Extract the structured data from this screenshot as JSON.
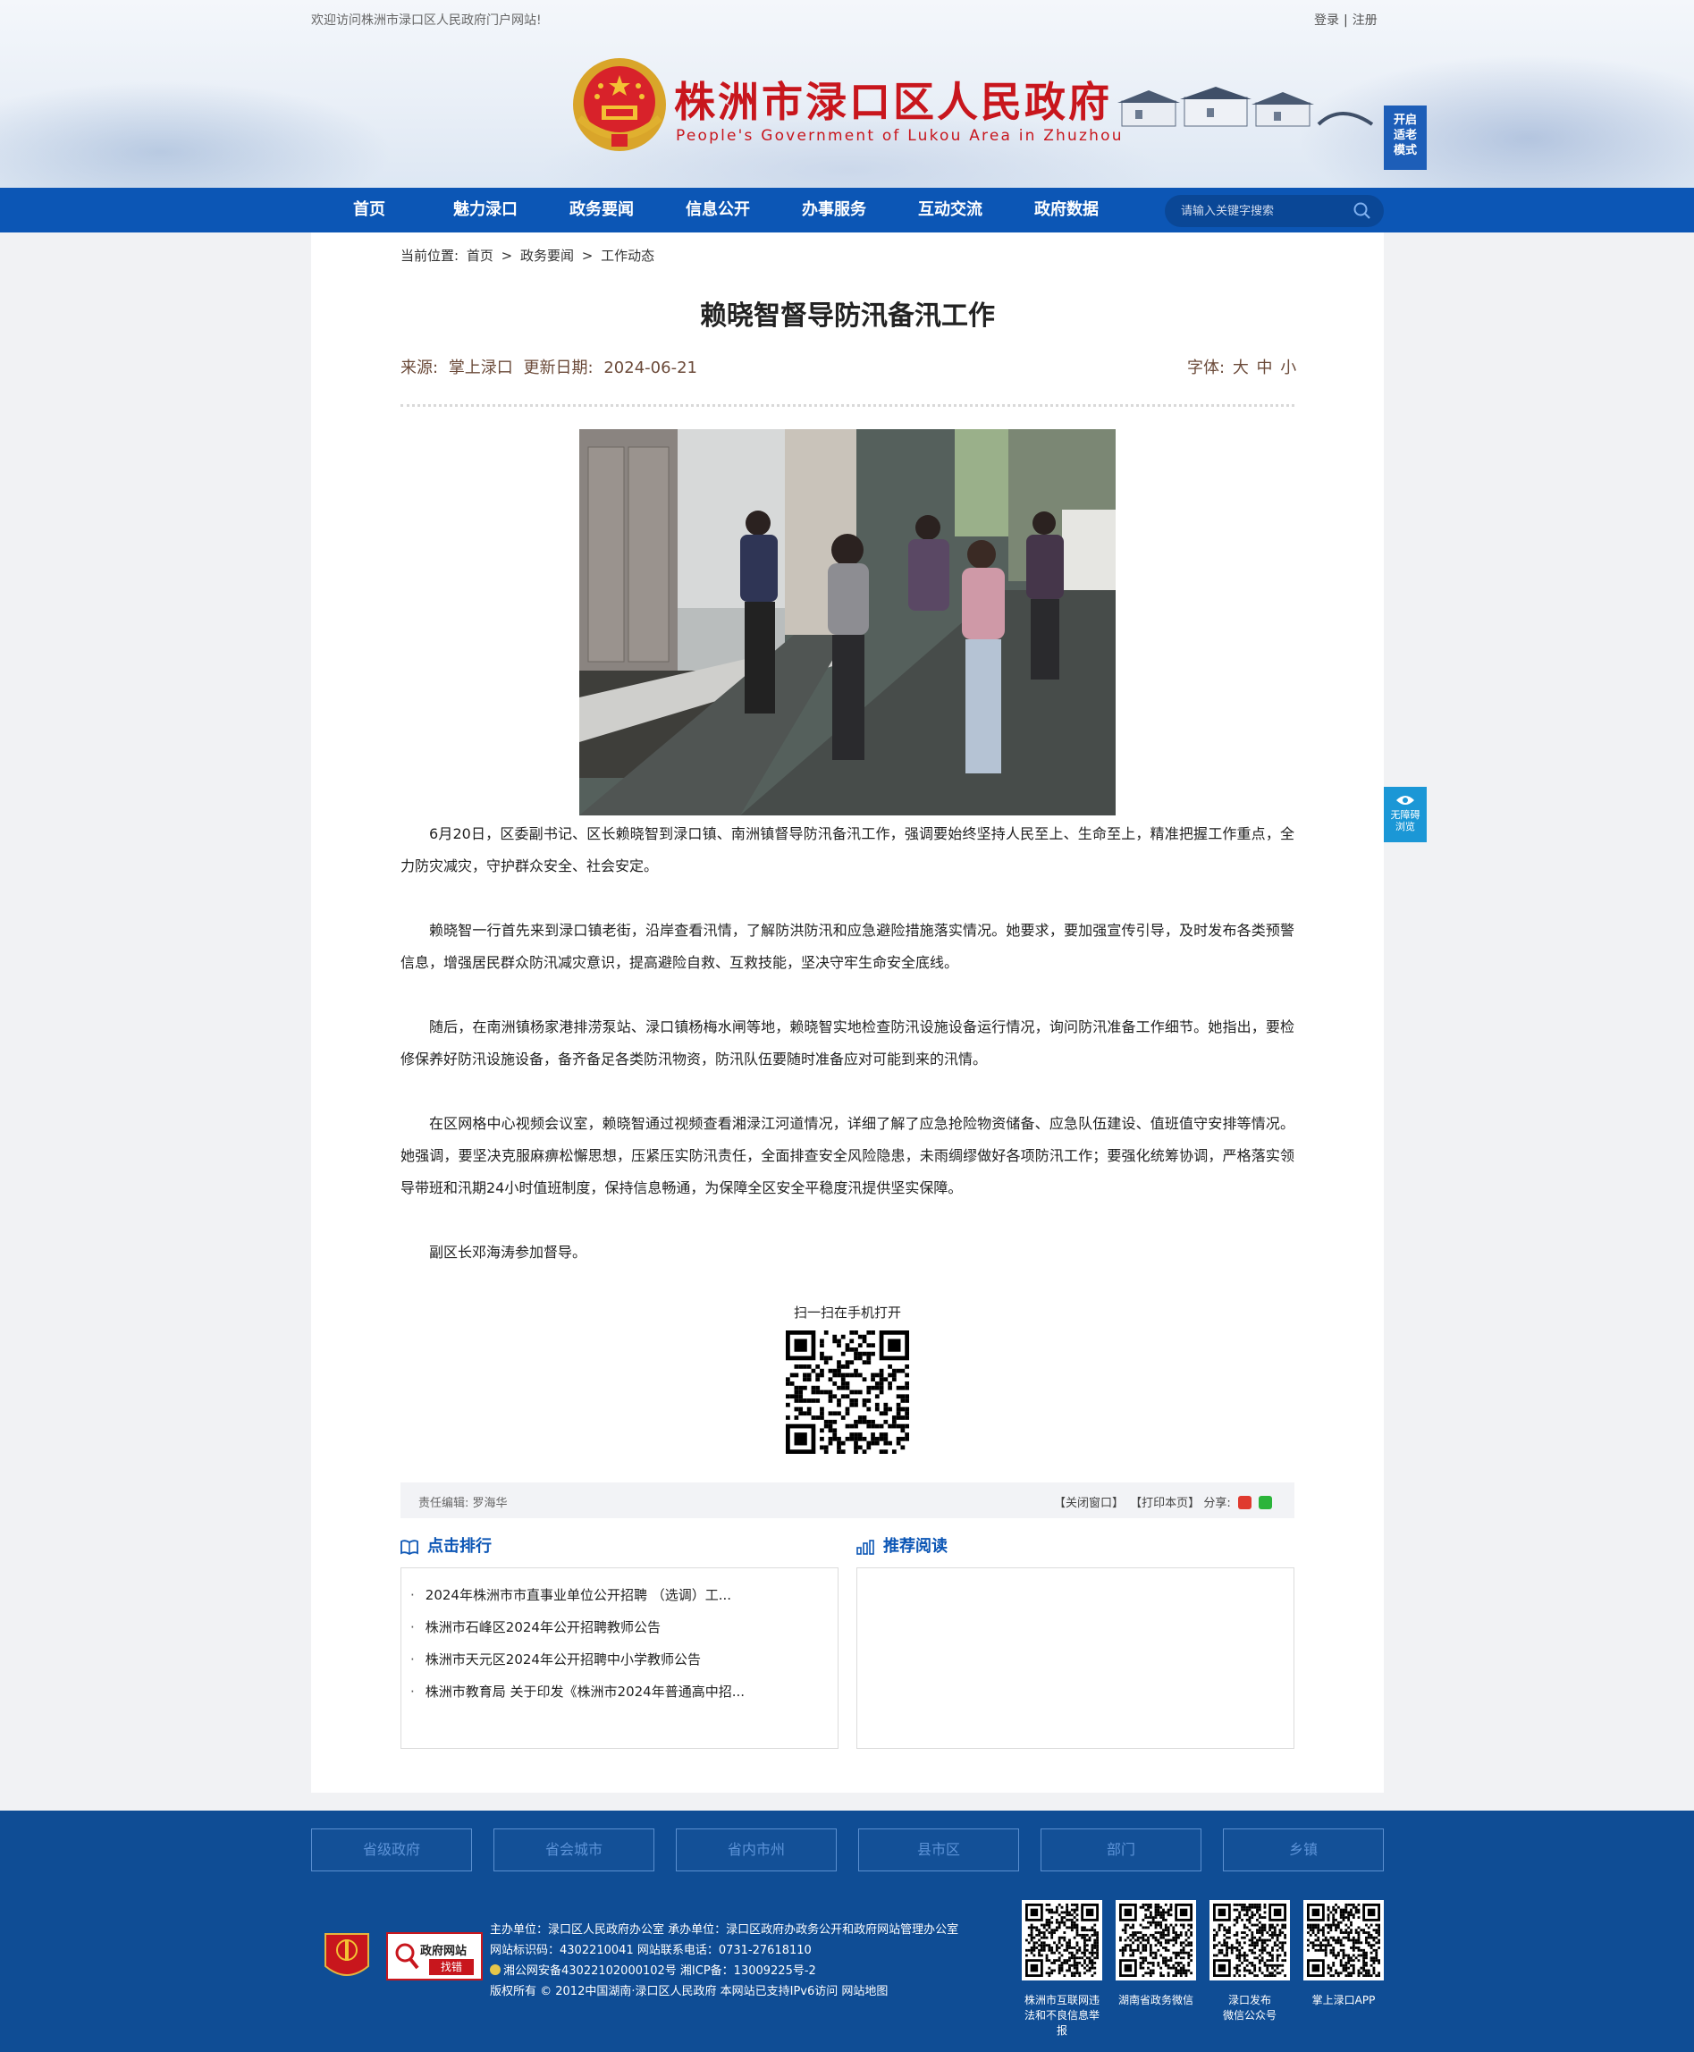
{
  "header": {
    "welcome": "欢迎访问株洲市渌口区人民政府门户网站!",
    "login": "登录",
    "sep": "|",
    "register": "注册",
    "title": "株洲市渌口区人民政府",
    "subtitle": "People's Government of Lukou Area in Zhuzhou",
    "elder_mode": [
      "开启",
      "适老",
      "模式"
    ]
  },
  "nav": {
    "items": [
      "首页",
      "魅力渌口",
      "政务要闻",
      "信息公开",
      "办事服务",
      "互动交流",
      "政府数据"
    ],
    "search_placeholder": "请输入关键字搜索"
  },
  "breadcrumb": {
    "prefix": "当前位置:",
    "items": [
      "首页",
      "政务要闻",
      "工作动态"
    ],
    "sep": ">"
  },
  "article": {
    "title": "赖晓智督导防汛备汛工作",
    "source_label": "来源:",
    "source": "掌上渌口",
    "date_label": "更新日期:",
    "date": "2024-06-21",
    "fontsize_label": "字体:",
    "font_sizes": [
      "大",
      "中",
      "小"
    ],
    "paragraphs": [
      "6月20日，区委副书记、区长赖晓智到渌口镇、南洲镇督导防汛备汛工作，强调要始终坚持人民至上、生命至上，精准把握工作重点，全力防灾减灾，守护群众安全、社会安定。",
      "赖晓智一行首先来到渌口镇老街，沿岸查看汛情，了解防洪防汛和应急避险措施落实情况。她要求，要加强宣传引导，及时发布各类预警信息，增强居民群众防汛减灾意识，提高避险自救、互救技能，坚决守牢生命安全底线。",
      "随后，在南洲镇杨家港排涝泵站、渌口镇杨梅水闸等地，赖晓智实地检查防汛设施设备运行情况，询问防汛准备工作细节。她指出，要检修保养好防汛设施设备，备齐备足各类防汛物资，防汛队伍要随时准备应对可能到来的汛情。",
      "在区网格中心视频会议室，赖晓智通过视频查看湘渌江河道情况，详细了解了应急抢险物资储备、应急队伍建设、值班值守安排等情况。她强调，要坚决克服麻痹松懈思想，压紧压实防汛责任，全面排查安全风险隐患，未雨绸缪做好各项防汛工作；要强化统筹协调，严格落实领导带班和汛期24小时值班制度，保持信息畅通，为保障全区安全平稳度汛提供坚实保障。",
      "副区长邓海涛参加督导。"
    ],
    "qr_label": "扫一扫在手机打开",
    "editor_label": "责任编辑:",
    "editor": "罗海华",
    "close_window": "【关闭窗口】",
    "print_page": "【打印本页】",
    "share_label": "分享:"
  },
  "ranking": {
    "title": "点击排行",
    "items": [
      "2024年株洲市市直事业单位公开招聘 （选调）工...",
      "株洲市石峰区2024年公开招聘教师公告",
      "株洲市天元区2024年公开招聘中小学教师公告",
      "株洲市教育局 关于印发《株洲市2024年普通高中招..."
    ]
  },
  "recommend": {
    "title": "推荐阅读"
  },
  "accessibility": [
    "无障碍",
    "浏览"
  ],
  "footer": {
    "links": [
      "省级政府",
      "省会城市",
      "省内市州",
      "县市区",
      "部门",
      "乡镇"
    ],
    "dangzheng": "党政机关",
    "gov_badge": [
      "政府网站",
      "找错"
    ],
    "info": {
      "host": "主办单位：渌口区人民政府办公室 承办单位：渌口区政府办政务公开和政府网站管理办公室",
      "site_id": "网站标识码：4302210041 网站联系电话：0731-27618110",
      "icp": "湘公网安备43022102000102号 湘ICP备：13009225号-2",
      "copyright": "版权所有 © 2012中国湖南·渌口区人民政府 本网站已支持IPv6访问",
      "sitemap": "网站地图"
    },
    "qrs": [
      [
        "株洲市互联网违",
        "法和不良信息举",
        "报"
      ],
      [
        "湖南省政务微信"
      ],
      [
        "渌口发布",
        "微信公众号"
      ],
      [
        "掌上渌口APP"
      ]
    ]
  },
  "colors": {
    "nav": "#0c56b5",
    "title_red": "#c8161d",
    "footer": "#0f4d95"
  }
}
